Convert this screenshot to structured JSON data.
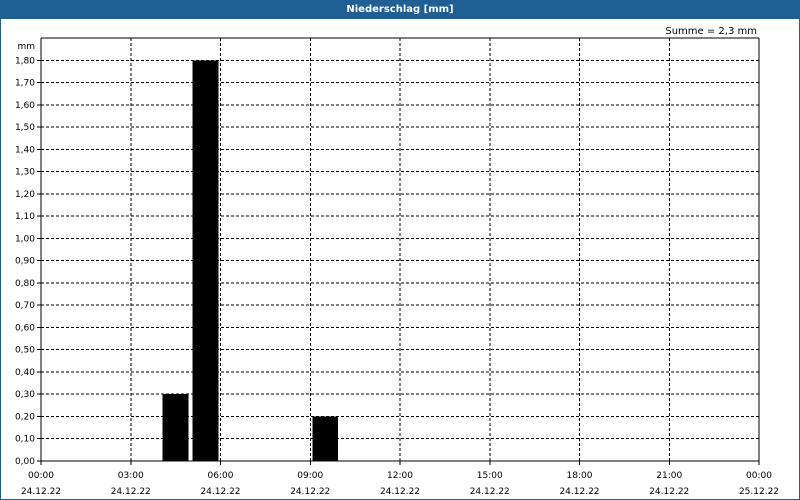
{
  "window": {
    "title": "Niederschlag [mm]"
  },
  "summary": {
    "text": "Summe = 2,3 mm"
  },
  "chart_data": {
    "type": "bar",
    "title": "Niederschlag [mm]",
    "ylabel": "mm",
    "xlabel": "",
    "ylim": [
      0,
      1.9
    ],
    "y_ticks": [
      "0,00",
      "0,10",
      "0,20",
      "0,30",
      "0,40",
      "0,50",
      "0,60",
      "0,70",
      "0,80",
      "0,90",
      "1,00",
      "1,10",
      "1,20",
      "1,30",
      "1,40",
      "1,50",
      "1,60",
      "1,70",
      "1,80"
    ],
    "x_range_hours": [
      0,
      24
    ],
    "x_ticks": [
      {
        "time": "00:00",
        "date": "24.12.22"
      },
      {
        "time": "03:00",
        "date": "24.12.22"
      },
      {
        "time": "06:00",
        "date": "24.12.22"
      },
      {
        "time": "09:00",
        "date": "24.12.22"
      },
      {
        "time": "12:00",
        "date": "24.12.22"
      },
      {
        "time": "15:00",
        "date": "24.12.22"
      },
      {
        "time": "18:00",
        "date": "24.12.22"
      },
      {
        "time": "21:00",
        "date": "24.12.22"
      },
      {
        "time": "00:00",
        "date": "25.12.22"
      }
    ],
    "bars": [
      {
        "hour": 4,
        "value": 0.3
      },
      {
        "hour": 5,
        "value": 1.8
      },
      {
        "hour": 9,
        "value": 0.2
      }
    ],
    "bar_color": "#000000",
    "grid": true,
    "grid_style": "dashed"
  }
}
